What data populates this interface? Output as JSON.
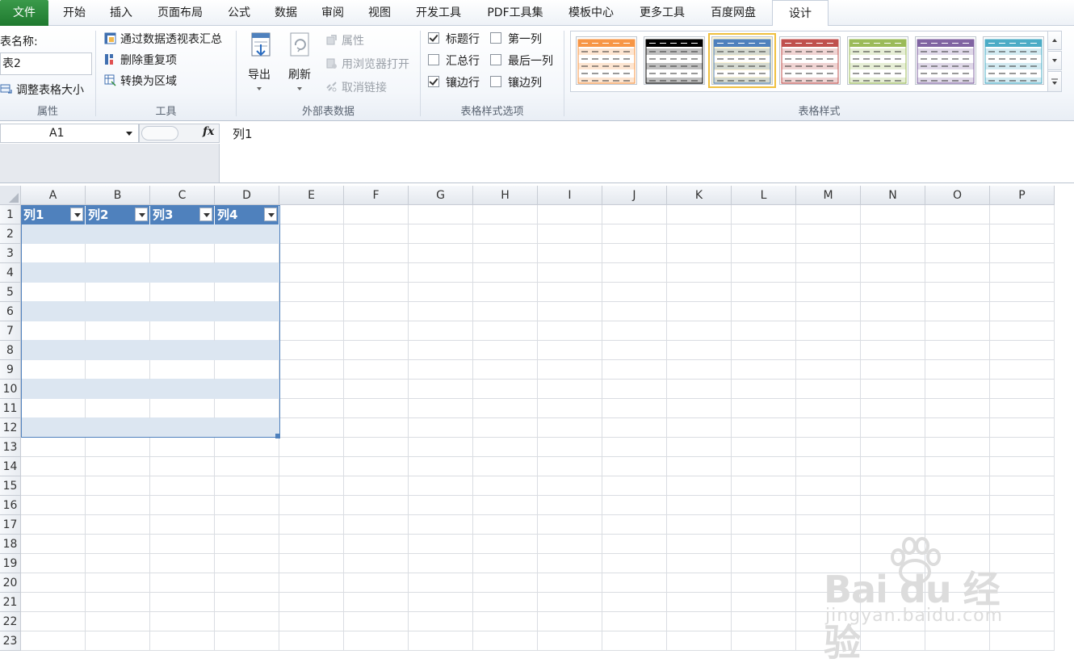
{
  "tabs": [
    {
      "label": "文件"
    },
    {
      "label": "开始"
    },
    {
      "label": "插入"
    },
    {
      "label": "页面布局"
    },
    {
      "label": "公式"
    },
    {
      "label": "数据"
    },
    {
      "label": "审阅"
    },
    {
      "label": "视图"
    },
    {
      "label": "开发工具"
    },
    {
      "label": "PDF工具集"
    },
    {
      "label": "模板中心"
    },
    {
      "label": "更多工具"
    },
    {
      "label": "百度网盘"
    },
    {
      "label": "设计"
    }
  ],
  "ribbon": {
    "properties": {
      "table_name_label": "表名称:",
      "table_name_value": "表2",
      "resize_label": "调整表格大小",
      "group_label": "属性"
    },
    "tools": {
      "pivot_label": "通过数据透视表汇总",
      "dedupe_label": "删除重复项",
      "convert_label": "转换为区域",
      "group_label": "工具"
    },
    "external": {
      "export_label": "导出",
      "refresh_label": "刷新",
      "properties_label": "属性",
      "open_browser_label": "用浏览器打开",
      "unlink_label": "取消链接",
      "group_label": "外部表数据"
    },
    "style_options": {
      "header_row": {
        "label": "标题行",
        "checked": true
      },
      "first_column": {
        "label": "第一列",
        "checked": false
      },
      "total_row": {
        "label": "汇总行",
        "checked": false
      },
      "last_column": {
        "label": "最后一列",
        "checked": false
      },
      "banded_rows": {
        "label": "镶边行",
        "checked": true
      },
      "banded_columns": {
        "label": "镶边列",
        "checked": false
      },
      "group_label": "表格样式选项"
    },
    "table_styles": {
      "group_label": "表格样式",
      "swatches": [
        {
          "color": "#f79646",
          "selected": false
        },
        {
          "color": "#000000",
          "selected": false
        },
        {
          "color": "#4f81bd",
          "selected": true
        },
        {
          "color": "#c0504d",
          "selected": false
        },
        {
          "color": "#9bbb59",
          "selected": false
        },
        {
          "color": "#8064a2",
          "selected": false
        },
        {
          "color": "#4bacc6",
          "selected": false
        }
      ]
    }
  },
  "formula_bar": {
    "name_box": "A1",
    "fx": "fx",
    "formula": "列1"
  },
  "sheet": {
    "columns": [
      "A",
      "B",
      "C",
      "D",
      "E",
      "F",
      "G",
      "H",
      "I",
      "J",
      "K",
      "L",
      "M",
      "N",
      "O",
      "P"
    ],
    "rows": [
      "1",
      "2",
      "3",
      "4",
      "5",
      "6",
      "7",
      "8",
      "9",
      "10",
      "11",
      "12",
      "13",
      "14",
      "15",
      "16",
      "17",
      "18",
      "19",
      "20",
      "21",
      "22",
      "23"
    ],
    "table_headers": [
      "列1",
      "列2",
      "列3",
      "列4"
    ],
    "table_accent": "#4f81bd",
    "band_color": "#dce6f1"
  },
  "watermark": {
    "main": "Bai du 经验",
    "sub": "jingyan.baidu.com"
  }
}
